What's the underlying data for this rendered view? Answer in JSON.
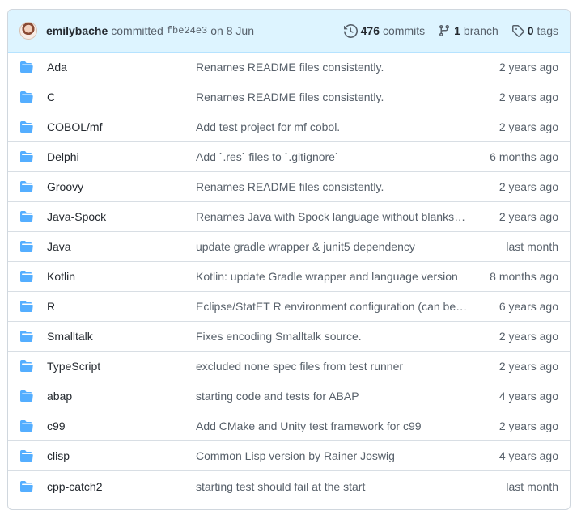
{
  "commit": {
    "author": "emilybache",
    "verb": "committed",
    "sha": "fbe24e3",
    "date": "on 8 Jun",
    "commits_count": "476",
    "commits_label": "commits",
    "branch_count": "1",
    "branch_label": "branch",
    "tags_count": "0",
    "tags_label": "tags"
  },
  "colors": {
    "folder": "#54aeff",
    "bar_bg": "#ddf4ff",
    "border": "#d0d7de"
  },
  "icons": {
    "folder": "folder-icon",
    "history": "history-icon",
    "branch": "git-branch-icon",
    "tag": "tag-icon"
  },
  "files": [
    {
      "name": "Ada",
      "message": "Renames README files consistently.",
      "age": "2 years ago"
    },
    {
      "name": "C",
      "message": "Renames README files consistently.",
      "age": "2 years ago"
    },
    {
      "name": "COBOL/mf",
      "message": "Add test project for mf cobol.",
      "age": "2 years ago"
    },
    {
      "name": "Delphi",
      "message": "Add `.res` files to `.gitignore`",
      "age": "6 months ago"
    },
    {
      "name": "Groovy",
      "message": "Renames README files consistently.",
      "age": "2 years ago"
    },
    {
      "name": "Java-Spock",
      "message": "Renames Java with Spock language without blanks in the name",
      "age": "2 years ago"
    },
    {
      "name": "Java",
      "message": "update gradle wrapper & junit5 dependency",
      "age": "last month"
    },
    {
      "name": "Kotlin",
      "message": "Kotlin: update Gradle wrapper and language version",
      "age": "8 months ago"
    },
    {
      "name": "R",
      "message": "Eclipse/StatET R environment configuration (can be ignored)",
      "age": "6 years ago"
    },
    {
      "name": "Smalltalk",
      "message": "Fixes encoding Smalltalk source.",
      "age": "2 years ago"
    },
    {
      "name": "TypeScript",
      "message": "excluded none spec files from test runner",
      "age": "2 years ago"
    },
    {
      "name": "abap",
      "message": "starting code and tests for ABAP",
      "age": "4 years ago"
    },
    {
      "name": "c99",
      "message": "Add CMake and Unity test framework for c99",
      "age": "2 years ago"
    },
    {
      "name": "clisp",
      "message": "Common Lisp version by Rainer Joswig",
      "age": "4 years ago"
    },
    {
      "name": "cpp-catch2",
      "message": "starting test should fail at the start",
      "age": "last month"
    }
  ]
}
